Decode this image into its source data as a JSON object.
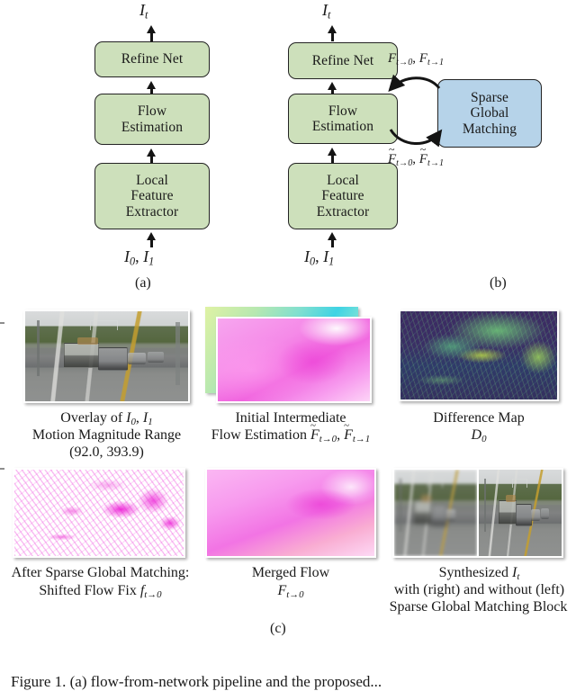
{
  "figure": {
    "subfigure_labels": {
      "a": "(a)",
      "b": "(b)",
      "c": "(c)"
    },
    "caption_partial": "Figure 1.  (a) flow-from-network pipeline and the proposed..."
  },
  "diagram_a": {
    "output_label": "I t",
    "blocks": [
      {
        "id": "refine-net",
        "label": "Refine Net",
        "color": "#cde0bb"
      },
      {
        "id": "flow-estimation",
        "label": "Flow\nEstimation",
        "color": "#cde0bb"
      },
      {
        "id": "local-feature-extractor",
        "label": "Local\nFeature\nExtractor",
        "color": "#cde0bb"
      }
    ],
    "input_label": "I 0 , I 1"
  },
  "diagram_b": {
    "output_label": "I t",
    "blocks": [
      {
        "id": "refine-net",
        "label": "Refine Net",
        "color": "#cde0bb"
      },
      {
        "id": "flow-estimation",
        "label": "Flow\nEstimation",
        "color": "#cde0bb"
      },
      {
        "id": "local-feature-extractor",
        "label": "Local\nFeature\nExtractor",
        "color": "#cde0bb"
      },
      {
        "id": "sparse-global-matching",
        "label": "Sparse\nGlobal\nMatching",
        "color": "#b6d3e9"
      }
    ],
    "input_label": "I 0 , I 1",
    "edge_top_label": "F t→0 , F t→1",
    "edge_bottom_label": "F̃ t→0 , F̃ t→1"
  },
  "panels": {
    "row1": [
      {
        "id": "overlay",
        "caption_lines": [
          "Overlay of I 0 , I 1",
          "Motion Magnitude Range",
          "(92.0, 393.9)"
        ],
        "motion_range": "(92.0, 393.9)"
      },
      {
        "id": "initial-intermediate-flow",
        "caption_lines": [
          "Initial Intermediate",
          "Flow Estimation F̃ t→0 , F̃ t→1"
        ]
      },
      {
        "id": "difference-map",
        "caption_lines": [
          "Difference Map",
          "D 0"
        ]
      }
    ],
    "row2": [
      {
        "id": "shifted-flow-fix",
        "caption_lines": [
          "After Sparse Global Matching:",
          "Shifted Flow Fix f t→0"
        ]
      },
      {
        "id": "merged-flow",
        "caption_lines": [
          "Merged Flow",
          "F t→0"
        ]
      },
      {
        "id": "synthesized-it",
        "caption_lines": [
          "Synthesized I t",
          "with (right) and without (left)",
          "Sparse Global Matching Block"
        ]
      }
    ]
  },
  "colors": {
    "block_green": "#cde0bb",
    "block_blue": "#b6d3e9",
    "stroke": "#232323",
    "background": "#ffffff"
  }
}
